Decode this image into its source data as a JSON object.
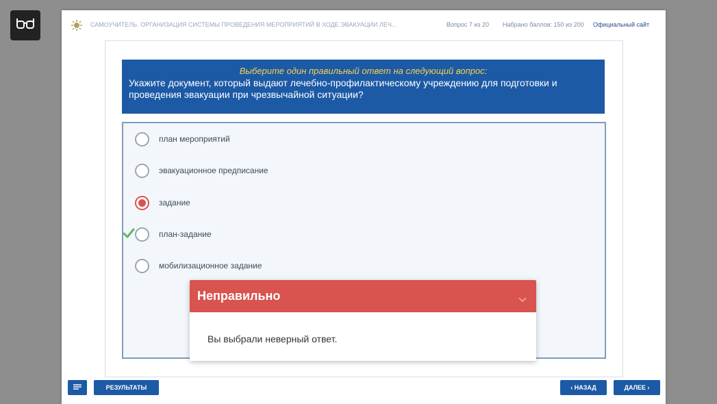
{
  "topbar": {
    "course_title": "САМОУЧИТЕЛЬ. ОРГАНИЗАЦИЯ СИСТЕМЫ ПРОВЕДЕНИЯ МЕРОПРИЯТИЙ В ХОДЕ ЭВАКУАЦИИ ЛЕЧ...",
    "progress": "Вопрос 7 из 20",
    "score": "Набрано баллов: 150 из 200",
    "site_link": "Официальный сайт"
  },
  "question": {
    "instruction": "Выберите один правильный ответ на следующий вопрос:",
    "text": "Укажите документ, который выдают лечебно-профилактическому учреждению для подготовки и проведения эвакуации при чрезвычайной ситуации?"
  },
  "answers": [
    {
      "label": "план мероприятий"
    },
    {
      "label": "эвакуационное предписание"
    },
    {
      "label": "задание"
    },
    {
      "label": "план-задание"
    },
    {
      "label": "мобилизационное задание"
    }
  ],
  "selected_answer": "задание",
  "correct_answer": "план-задание",
  "feedback": {
    "title": "Неправильно",
    "message": "Вы выбрали неверный ответ."
  },
  "nav": {
    "results_label": "РЕЗУЛЬТАТЫ",
    "back_label": "‹ НАЗАД",
    "next_label": "ДАЛЕЕ ›"
  },
  "icons": {
    "accessibility": "glasses-icon",
    "logo": "sun-logo-icon",
    "menu": "list-icon",
    "correct": "checkmark-icon",
    "collapse": "chevron-down-icon"
  },
  "colors": {
    "question_bg": "#1c5aa6",
    "instruction_text": "#f6d24b",
    "incorrect": "#d9534f",
    "correct_check": "#5cb85c",
    "button_bg": "#1c5aa6"
  }
}
